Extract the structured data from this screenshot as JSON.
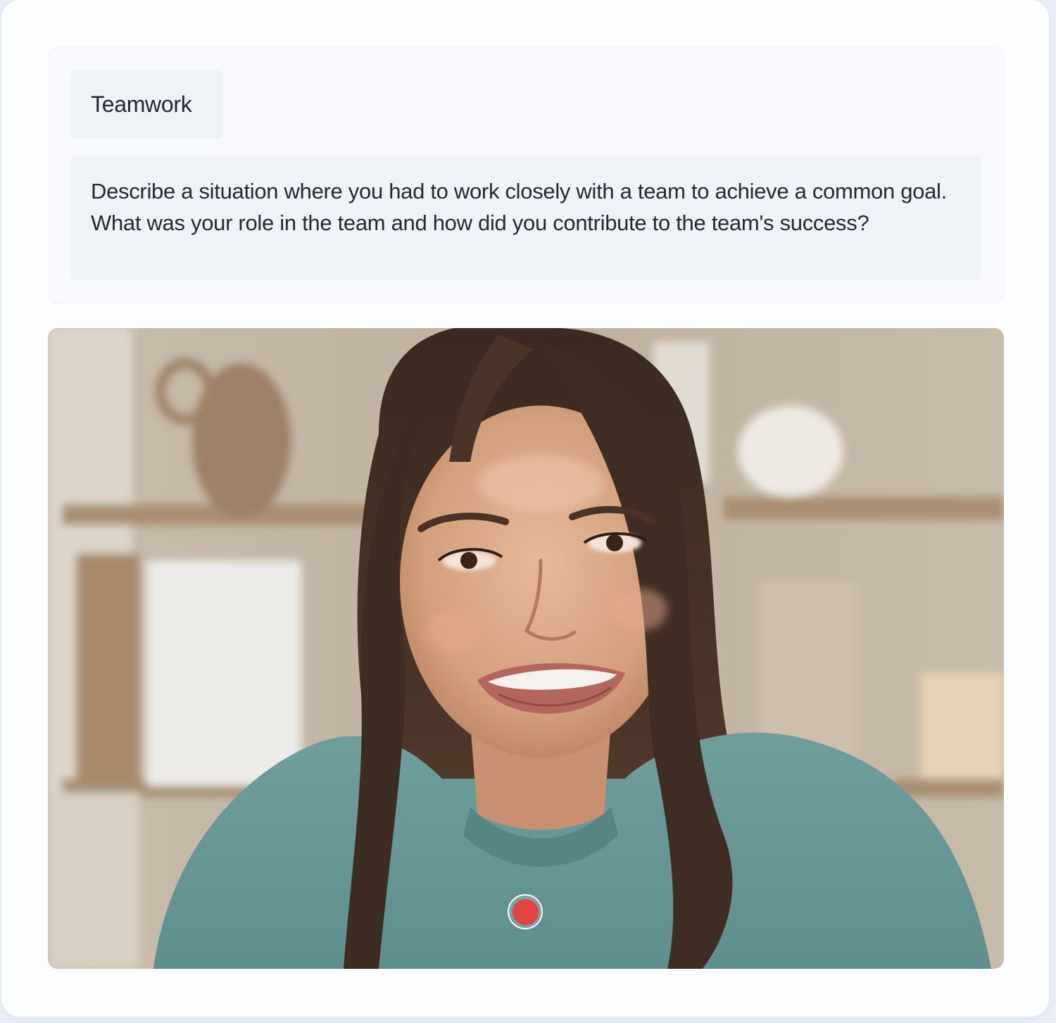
{
  "question": {
    "category": "Teamwork",
    "text": "Describe a situation where you had to work closely with a team to achieve a common goal. What was your role in the team and how did you contribute to the team's success?"
  },
  "video": {
    "subject": "candidate-webcam-feed"
  },
  "controls": {
    "record_button_color": "#e3453f"
  }
}
